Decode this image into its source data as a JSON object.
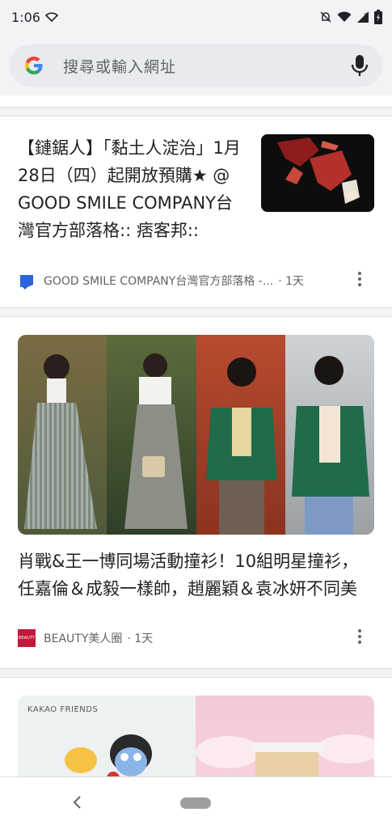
{
  "status": {
    "time": "1:06"
  },
  "search": {
    "placeholder": "搜尋或輸入網址"
  },
  "cards": [
    {
      "title": "【鏈鋸人】「黏土人淀治」1月28日（四）起開放預購★ @ GOOD SMILE COMPANY台灣官方部落格:: 痞客邦::",
      "source": "GOOD SMILE COMPANY台灣官方部落格 -...",
      "time": "· 1天"
    },
    {
      "title": "肖戰&王一博同場活動撞衫！10組明星撞衫，任嘉倫＆成毅一樣帥，趙麗穎＆袁冰妍不同美",
      "source": "BEAUTY美人圈",
      "time": "· 1天",
      "badge": "BEAUTY"
    },
    {
      "image_label": "KAKAO FRIENDS"
    }
  ],
  "colors": {
    "accent_red": "#c2183a",
    "google_blue": "#4285f4",
    "jacket_green": "#1f6b4a"
  }
}
